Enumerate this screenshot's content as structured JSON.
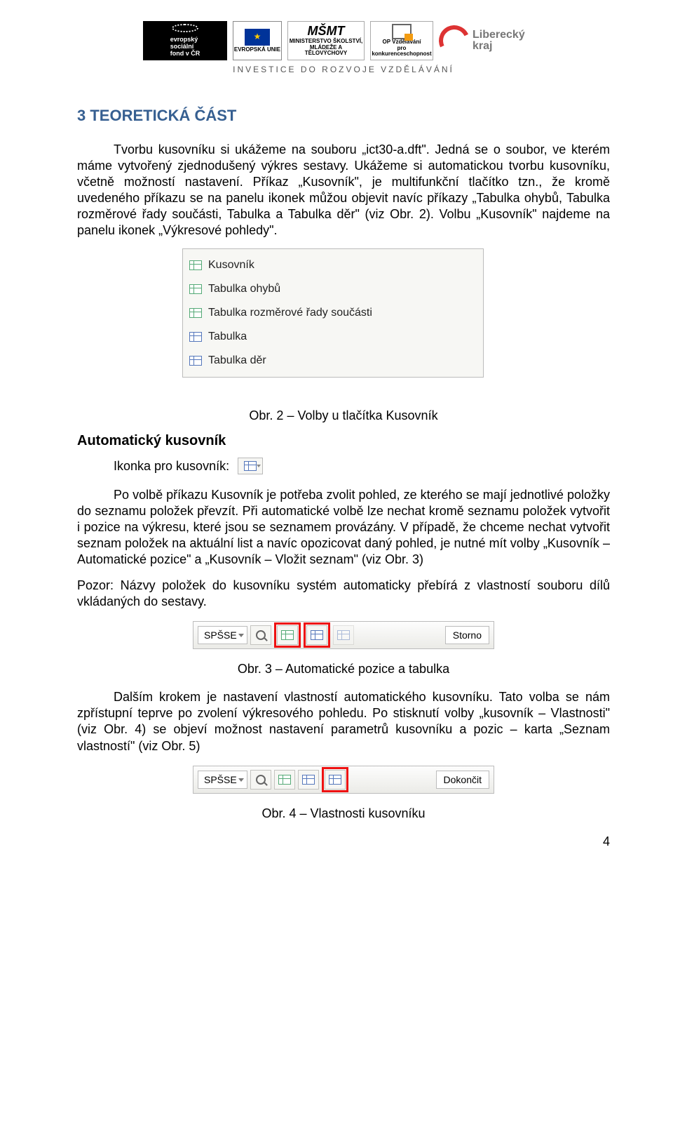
{
  "header": {
    "esf": "evropský\nsociální\nfond v ČR",
    "eu": "EVROPSKÁ UNIE",
    "msmt_mark": "MŠMT",
    "msmt": "MINISTERSTVO ŠKOLSTVÍ,\nMLÁDEŽE A TĚLOVÝCHOVY",
    "opvk": "OP Vzdělávání\npro konkurenceschopnost",
    "kraj": "Liberecký\nkraj",
    "tagline": "INVESTICE DO ROZVOJE VZDĚLÁVÁNÍ"
  },
  "section_title": "3 TEORETICKÁ ČÁST",
  "para1": "Tvorbu kusovníku si ukážeme na souboru „ict30-a.dft\". Jedná se o soubor, ve kterém máme vytvořený zjednodušený výkres sestavy. Ukážeme si automatickou tvorbu kusovníku, včetně možností nastavení. Příkaz „Kusovník\", je multifunkční tlačítko tzn., že kromě uvedeného příkazu se na panelu ikonek můžou objevit navíc příkazy „Tabulka ohybů, Tabulka rozměrové řady součásti, Tabulka a Tabulka děr\" (viz Obr. 2). Volbu „Kusovník\" najdeme na panelu ikonek „Výkresové pohledy\".",
  "menu": {
    "items": [
      {
        "label": "Kusovník"
      },
      {
        "label": "Tabulka ohybů"
      },
      {
        "label": "Tabulka rozměrové řady součásti"
      },
      {
        "label": "Tabulka"
      },
      {
        "label": "Tabulka děr"
      }
    ]
  },
  "caption_fig2": "Obr. 2 – Volby u tlačítka Kusovník",
  "sub_heading": "Automatický kusovník",
  "ikonka_label": "Ikonka pro kusovník:",
  "para2": "Po volbě příkazu Kusovník je potřeba zvolit pohled, ze kterého se mají jednotlivé položky do seznamu položek převzít. Při automatické volbě lze nechat kromě seznamu položek vytvořit i pozice na výkresu, které jsou se seznamem provázány. V případě, že chceme nechat vytvořit seznam položek na aktuální list a navíc opozicovat daný pohled, je nutné mít volby „Kusovník – Automatické pozice\" a „Kusovník – Vložit seznam\" (viz Obr. 3)",
  "para3": "Pozor: Názvy položek do kusovníku systém automaticky přebírá z vlastností souboru dílů vkládaných do sestavy.",
  "toolbar1": {
    "combo": "SPŠSE",
    "end": "Storno"
  },
  "caption_fig3": "Obr. 3 – Automatické pozice a tabulka",
  "para4": "Dalším krokem je nastavení vlastností automatického kusovníku. Tato volba se nám zpřístupní teprve po zvolení výkresového pohledu. Po stisknutí volby „kusovník – Vlastnosti\" (viz Obr. 4) se objeví možnost nastavení parametrů kusovníku a pozic – karta „Seznam vlastností\" (viz Obr. 5)",
  "toolbar2": {
    "combo": "SPŠSE",
    "end": "Dokončit"
  },
  "caption_fig4": "Obr. 4 – Vlastnosti kusovníku",
  "page_number": "4"
}
